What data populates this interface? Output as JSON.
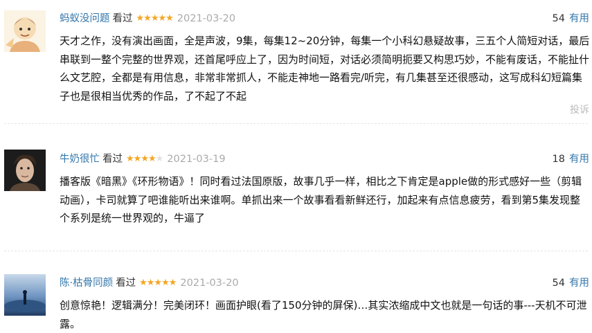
{
  "reviews": [
    {
      "author": "蚂蚁没问题",
      "watched": "看过",
      "rating": 5,
      "date": "2021-03-20",
      "votes": "54",
      "useful_label": "有用",
      "content": "天才之作，没有演出画面，全是声波，9集，每集12~20分钟，每集一个小科幻悬疑故事，三五个人简短对话，最后串联到一整个完整的世界观，还首尾呼应上了，因为时间短，对话必须简明扼要又构思巧妙，不能有废话，不能扯什么文艺腔，全都是有用信息，非常非常抓人，不能走神地一路看完/听完，有几集甚至还很感动，这写成科幻短篇集子也是很相当优秀的作品，了不起了不起",
      "report_label": "投诉",
      "avatar_colors": [
        "#f6e6c8",
        "#e8b07a",
        "#c98452"
      ]
    },
    {
      "author": "牛奶很忙",
      "watched": "看过",
      "rating": 4,
      "date": "2021-03-19",
      "votes": "18",
      "useful_label": "有用",
      "content": "播客版《暗黑》《环形物语》！同时看过法国原版，故事几乎一样，相比之下肯定是apple做的形式感好一些（剪辑动画），卡司就算了吧谁能听出来谁啊。单抓出来一个故事看看新鲜还行，加起来有点信息疲劳，看到第5集发现整个系列是统一世界观的，牛逼了",
      "avatar_colors": [
        "#2b2b2b",
        "#d9b8a0",
        "#8a6a52"
      ]
    },
    {
      "author": "陈·枯骨同颜",
      "watched": "看过",
      "rating": 5,
      "date": "2021-03-20",
      "votes": "54",
      "useful_label": "有用",
      "content": "创意惊艳！逻辑满分！完美闭环！画面护眼(看了150分钟的屏保)…其实浓缩成中文也就是一句话的事---天机不可泄露。",
      "avatar_colors": [
        "#1f3b63",
        "#6d93c0",
        "#c7d8ea"
      ]
    }
  ],
  "colors": {
    "link": "#3377aa",
    "star": "#f5a623",
    "muted": "#aaaaaa"
  }
}
